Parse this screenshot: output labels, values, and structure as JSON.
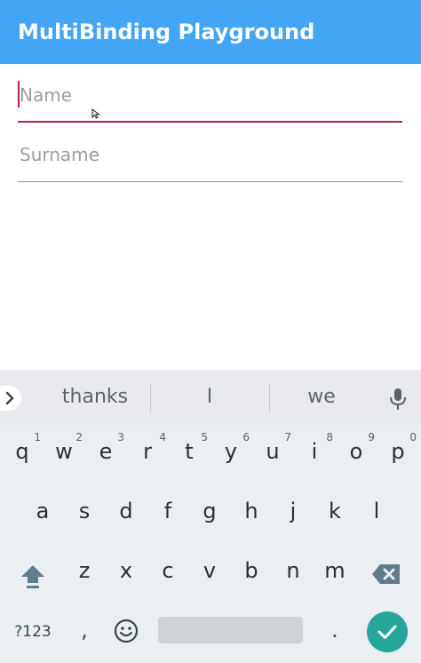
{
  "app": {
    "title": "MultiBinding Playground"
  },
  "form": {
    "name_placeholder": "Name",
    "surname_placeholder": "Surname"
  },
  "keyboard": {
    "suggestions": [
      "thanks",
      "I",
      "we"
    ],
    "rows": [
      [
        {
          "k": "q",
          "h": "1"
        },
        {
          "k": "w",
          "h": "2"
        },
        {
          "k": "e",
          "h": "3"
        },
        {
          "k": "r",
          "h": "4"
        },
        {
          "k": "t",
          "h": "5"
        },
        {
          "k": "y",
          "h": "6"
        },
        {
          "k": "u",
          "h": "7"
        },
        {
          "k": "i",
          "h": "8"
        },
        {
          "k": "o",
          "h": "9"
        },
        {
          "k": "p",
          "h": "0"
        }
      ],
      [
        {
          "k": "a"
        },
        {
          "k": "s"
        },
        {
          "k": "d"
        },
        {
          "k": "f"
        },
        {
          "k": "g"
        },
        {
          "k": "h"
        },
        {
          "k": "j"
        },
        {
          "k": "k"
        },
        {
          "k": "l"
        }
      ],
      [
        {
          "k": "z"
        },
        {
          "k": "x"
        },
        {
          "k": "c"
        },
        {
          "k": "v"
        },
        {
          "k": "b"
        },
        {
          "k": "n"
        },
        {
          "k": "m"
        }
      ]
    ],
    "symbols_label": "?123",
    "comma_label": ",",
    "period_label": ".",
    "icons": {
      "expand": "chevron-right-icon",
      "mic": "mic-icon",
      "shift": "shift-icon",
      "backspace": "backspace-icon",
      "emoji": "emoji-icon",
      "done": "checkmark-icon"
    }
  },
  "colors": {
    "appbar": "#42a5f5",
    "focus_accent": "#c2185b",
    "keyboard_bg": "#eceff1",
    "done_button": "#26a69a"
  }
}
